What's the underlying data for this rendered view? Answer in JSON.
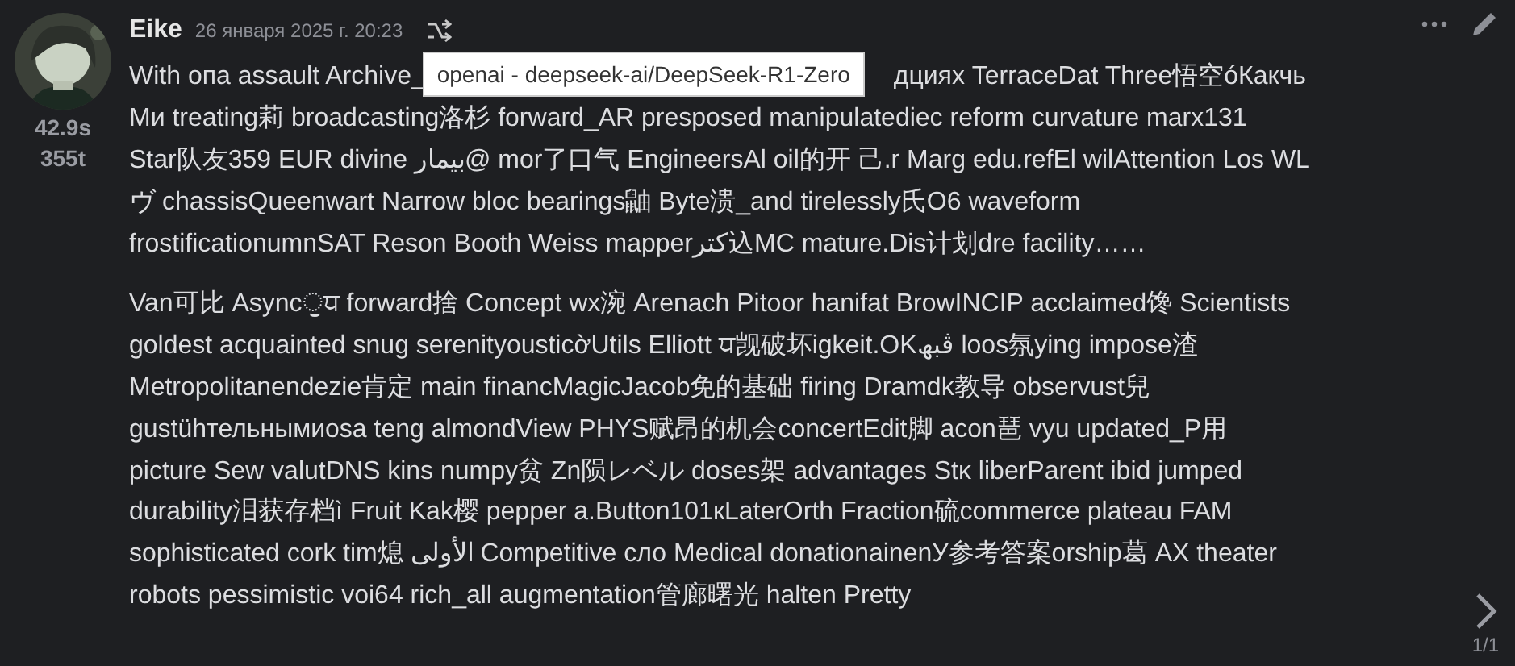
{
  "message": {
    "author": "Eike",
    "timestamp": "26 января 2025 г. 20:23",
    "stats": [
      "42.9s",
      "355t"
    ],
    "tooltip": "openai - deepseek-ai/DeepSeek-R1-Zero",
    "paragraphs": [
      {
        "lines": [
          [
            "With опа assault Archive_",
            "дциях TerraceDat Three悟空óКакчь"
          ],
          [
            "Ми treating莉 broadcasting洛杉 forward_AR presposed manipulatediec reform curvature marx131"
          ],
          [
            "Star队友359 EUR divine بیمار@ mor了口气 EngineersAl oil的开 己.r Marg edu.refEl wilAttention Los WL"
          ],
          [
            "ヴ chassisQueenwart Narrow bloc bearings鼬 Byte溃_and tirelessly氏O6 waveform"
          ],
          [
            "frostificationumnSAT Reson Booth Weiss mapperكتر込MC mature.Dis计划dre facility……"
          ]
        ]
      },
      {
        "lines": [
          [
            "Van可比 Asyncੁਧ forward捨 Concept wx涴 Arenach Pitoor hanifat BrowINCIP acclaimed馋 Scientists"
          ],
          [
            "goldest acquainted snug serenityousticờUtils Elliott ਧ觊破坏igkeit.OKڤبھ loos氛ying impose渣"
          ],
          [
            "Metropolitanendezie肯定 main financMagicJacob免的基础 firing Dramdk教导 observust兒"
          ],
          [
            "gustühтельнымиosa teng almondView PHYS赋昂的机会concertEdit脚 acon琶 vyu updated_P用"
          ],
          [
            "picture Sew valutDNS kins numpy贫 Zn陨レベル doses架 advantages Stκ liberParent ibid jumped"
          ],
          [
            "durability泪获存档ì Fruit Kak樱 pepper a.Button101кLaterOrth Fraction硫commerce plateau FAM"
          ],
          [
            "sophisticated cork tim熄 الأولى Competitive сло Medical donationainenУ参考答案orship葛 AX theater"
          ],
          [
            "robots pessimistic voi64 rich_all augmentation管廊曙光 halten Pretty"
          ]
        ]
      }
    ]
  },
  "pager": {
    "label": "1/1"
  }
}
